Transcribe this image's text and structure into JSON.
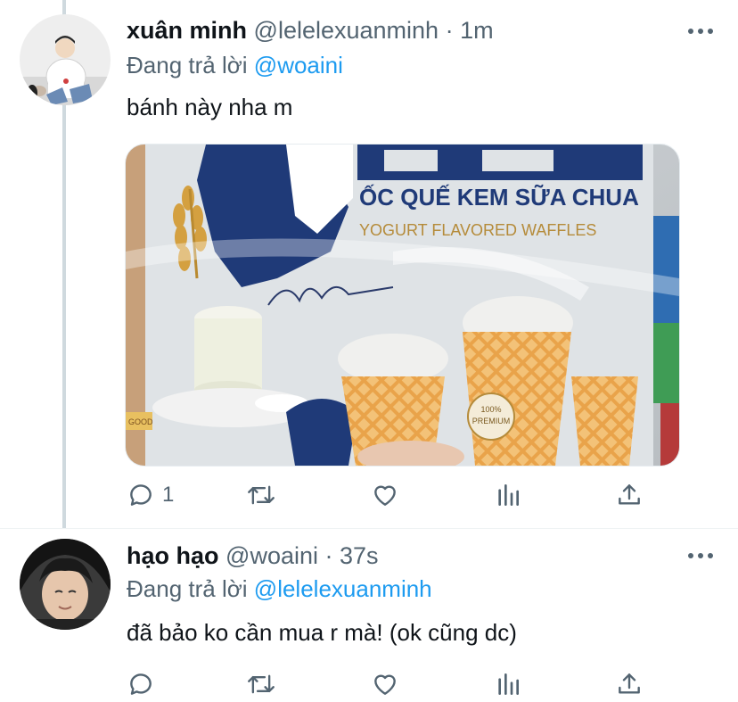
{
  "tweets": [
    {
      "name": "xuân minh",
      "handle": "@lelelexuanminh",
      "separator": "·",
      "time": "1m",
      "reply_label": "Đang trả lời",
      "reply_to": "@woaini",
      "text": "bánh này nha m",
      "media": {
        "package_title": "ỐC QUẾ KEM SỮA CHUA",
        "package_subtitle": "YOGURT FLAVORED WAFFLES",
        "badge_line1": "100%",
        "badge_line2": "PREMIUM",
        "corner_label": "GOOD"
      },
      "reply_count": "1"
    },
    {
      "name": "hạo hạo",
      "handle": "@woaini",
      "separator": "·",
      "time": "37s",
      "reply_label": "Đang trả lời",
      "reply_to": "@lelelexuanminh",
      "text": "đã bảo ko cần mua r mà! (ok cũng dc)"
    }
  ],
  "icons": [
    "more-icon",
    "reply-icon",
    "retweet-icon",
    "like-icon",
    "analytics-icon",
    "share-icon"
  ],
  "colors": {
    "link": "#1d9bf0",
    "muted": "#536471",
    "text": "#0f1419",
    "thread_line": "#cfd9de"
  }
}
